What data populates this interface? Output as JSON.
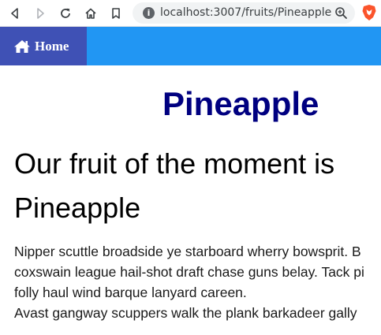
{
  "browser": {
    "url": "localhost:3007/fruits/Pineapple"
  },
  "nav": {
    "home_label": "Home"
  },
  "page": {
    "title": "Pineapple",
    "subtitle": "Our fruit of the moment is Pineapple",
    "body_lines": [
      "Nipper scuttle broadside ye starboard wherry bowsprit. B",
      "coxswain league hail-shot draft chase guns belay. Tack pi",
      "folly haul wind barque lanyard careen.",
      "Avast gangway scuppers walk the plank barkadeer gally"
    ]
  },
  "colors": {
    "nav_bar": "#2196f3",
    "home_button": "#3f51b5",
    "title": "#000080"
  }
}
